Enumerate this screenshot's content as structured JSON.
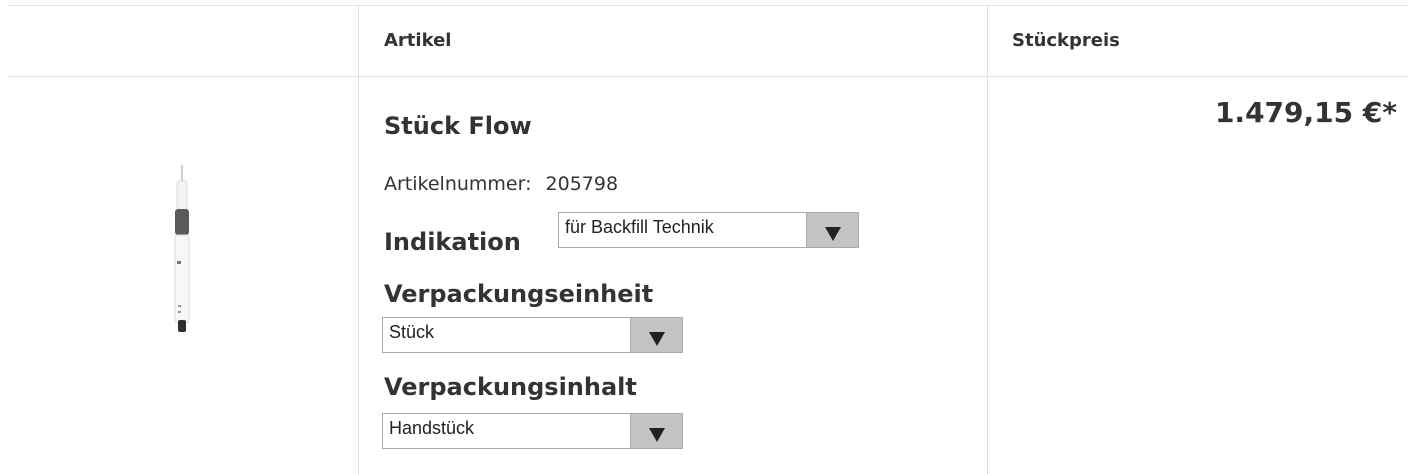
{
  "table": {
    "header": {
      "col_article": "Artikel",
      "col_unit_price": "Stückpreis"
    }
  },
  "product": {
    "name": "Stück Flow",
    "article_number_label": "Artikelnummer:",
    "article_number_value": "205798",
    "image_icon": "handpiece-device-icon",
    "options": {
      "indication": {
        "label": "Indikation",
        "selected": "für Backfill Technik"
      },
      "packaging_unit": {
        "label": "Verpackungseinheit",
        "selected": "Stück"
      },
      "packaging_content": {
        "label": "Verpackungsinhalt",
        "selected": "Handstück"
      }
    },
    "price": "1.479,15 €*"
  }
}
